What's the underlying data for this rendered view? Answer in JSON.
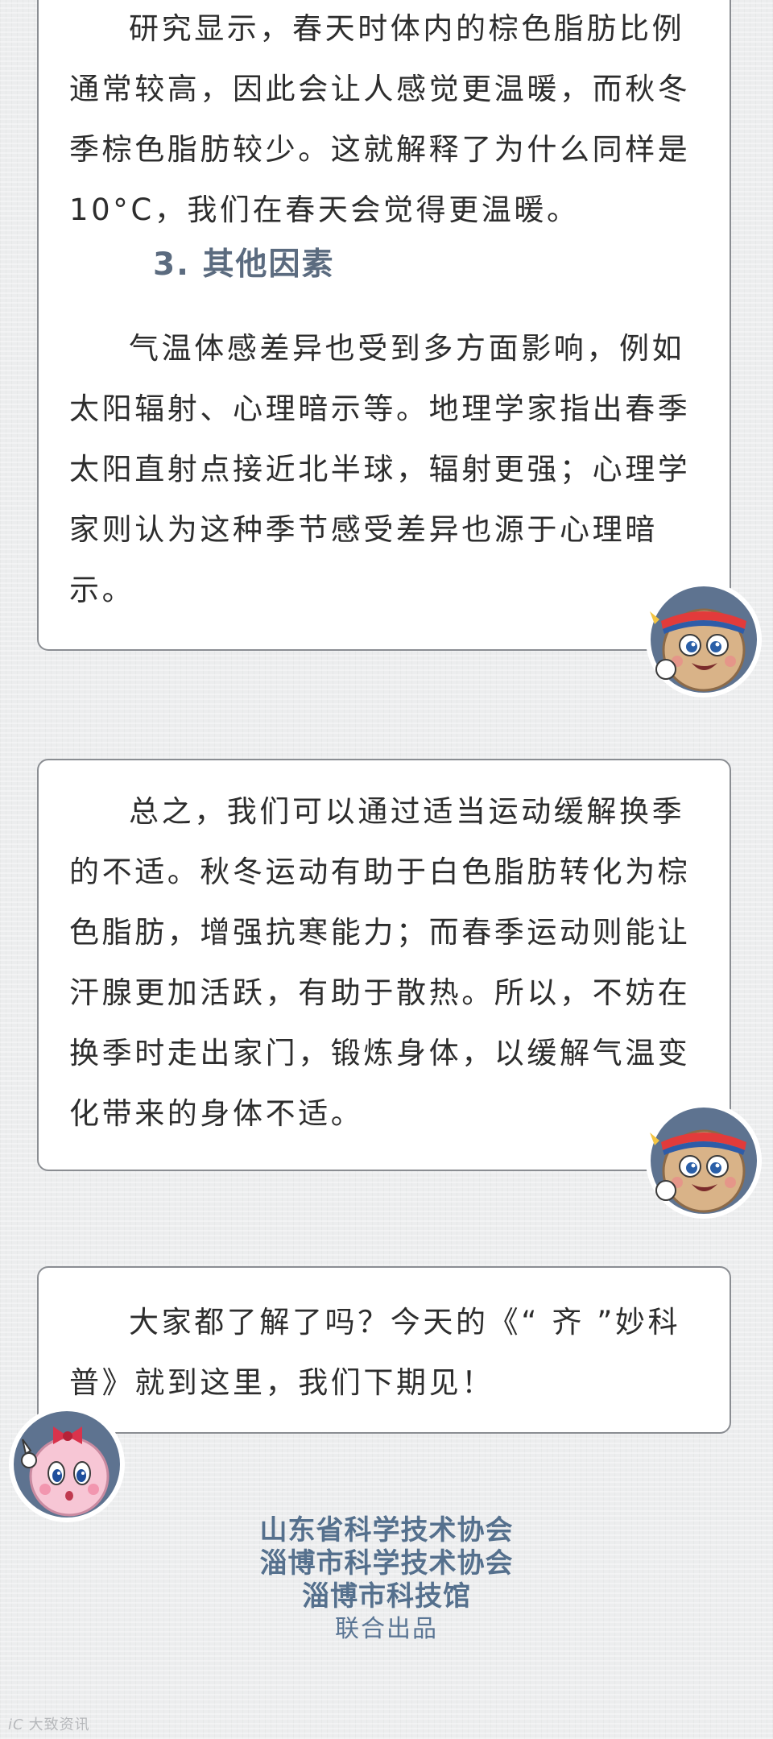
{
  "sections": [
    {
      "paragraphs": [
        "研究显示，春天时体内的棕色脂肪比例通常较高，因此会让人感觉更温暖，而秋冬季棕色脂肪较少。这就解释了为什么同样是 10°C，我们在春天会觉得更温暖。"
      ],
      "heading": "3. 其他因素",
      "paragraphs_after": [
        "气温体感差异也受到多方面影响，例如太阳辐射、心理暗示等。地理学家指出春季太阳直射点接近北半球，辐射更强；心理学家则认为这种季节感受差异也源于心理暗示。"
      ]
    },
    {
      "paragraphs": [
        "总之，我们可以通过适当运动缓解换季的不适。秋冬运动有助于白色脂肪转化为棕色脂肪，增强抗寒能力；而春季运动则能让汗腺更加活跃，有助于散热。所以，不妨在换季时走出家门，锻炼身体，以缓解气温变化带来的身体不适。"
      ]
    },
    {
      "paragraphs": [
        "大家都了解了吗？今天的《“ 齐 ”妙科普》就到这里，我们下期见！"
      ]
    }
  ],
  "credits": {
    "org1": "山东省科学技术协会",
    "org2": "淄博市科学技术协会",
    "org3": "淄博市科技馆",
    "note": "联合出品"
  },
  "watermark": {
    "mark": "iC",
    "text": "大致资讯"
  },
  "avatars": {
    "mascot_male_icon": "fat-cell-mascot-icon",
    "mascot_female_icon": "pink-cell-mascot-icon",
    "frame_color": "#5e7390",
    "male_face_color": "#c9a47c",
    "female_face_color": "#f6c3d3"
  },
  "colors": {
    "heading": "#5b6b7f",
    "credits": "#55708d",
    "card_border": "#8a8d92"
  }
}
